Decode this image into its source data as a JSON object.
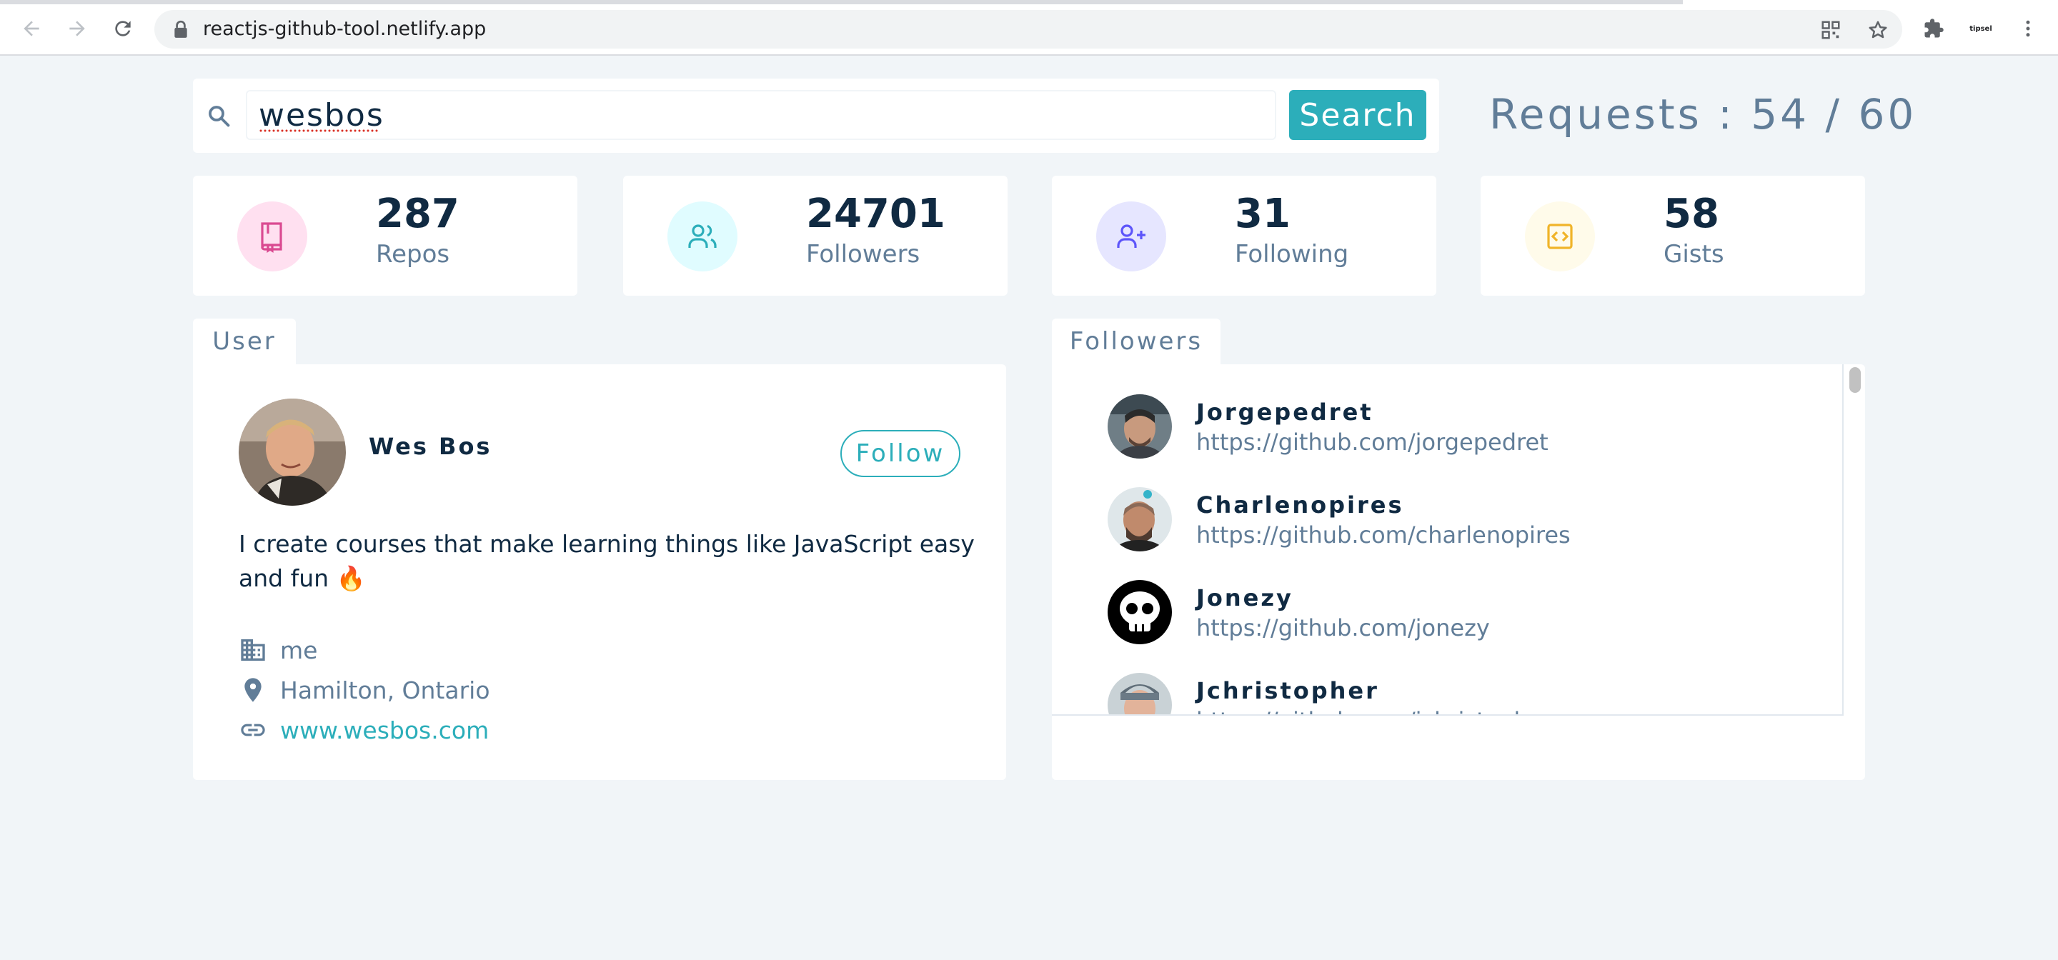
{
  "browser": {
    "url": "reactjs-github-tool.netlify.app",
    "ext_label": "tipsel"
  },
  "search": {
    "value": "wesbos",
    "button_label": "Search"
  },
  "requests": "Requests : 54 / 60",
  "stats": [
    {
      "value": "287",
      "label": "Repos",
      "icon": "book-icon",
      "color": "#da4a91",
      "bg": "#ffe0f0"
    },
    {
      "value": "24701",
      "label": "Followers",
      "icon": "users-icon",
      "color": "#2caeba",
      "bg": "#e0fcff"
    },
    {
      "value": "31",
      "label": "Following",
      "icon": "user-plus-icon",
      "color": "#5d55fa",
      "bg": "#e6e6ff"
    },
    {
      "value": "58",
      "label": "Gists",
      "icon": "code-icon",
      "color": "#f0b429",
      "bg": "#fffbea"
    }
  ],
  "user": {
    "tab": "User",
    "name": "Wes Bos",
    "follow_label": "Follow",
    "bio": "I create courses that make learning things like JavaScript easy and fun 🔥",
    "company": "me",
    "location": "Hamilton, Ontario",
    "blog": "www.wesbos.com"
  },
  "followers": {
    "tab": "Followers",
    "items": [
      {
        "name": "Jorgepedret",
        "url": "https://github.com/jorgepedret"
      },
      {
        "name": "Charlenopires",
        "url": "https://github.com/charlenopires"
      },
      {
        "name": "Jonezy",
        "url": "https://github.com/jonezy"
      },
      {
        "name": "Jchristopher",
        "url": "https://github.com/jchristopher"
      }
    ]
  },
  "colors": {
    "accent": "#2caeba",
    "page_bg": "#f1f5f8",
    "text_dark": "#102a42",
    "text_muted": "#617d98"
  }
}
